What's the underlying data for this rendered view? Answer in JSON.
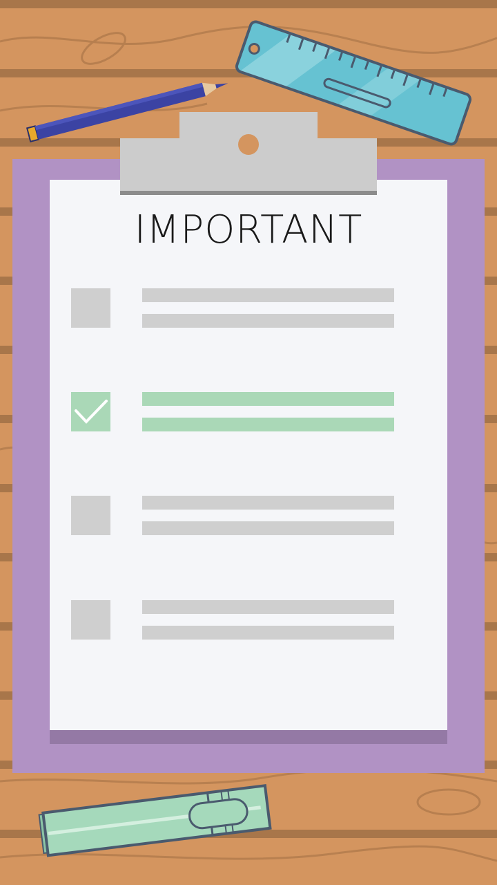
{
  "title": "IMPORTANT",
  "colors": {
    "wood": "#d4955f",
    "plank_line": "#a8764a",
    "clipboard": "#b192c4",
    "clipboard_bottom": "#9479a5",
    "paper": "#f5f6f9",
    "clip": "#cccccc",
    "placeholder": "#cfcfcf",
    "checked": "#aad8b7",
    "pencil": "#3b43a3",
    "ruler": "#66c2d2",
    "marker": "#a5d9bb"
  },
  "checklist": [
    {
      "checked": false
    },
    {
      "checked": true
    },
    {
      "checked": false
    },
    {
      "checked": false
    }
  ],
  "icons": [
    "pencil-icon",
    "ruler-icon",
    "marker-icon",
    "checkmark-icon"
  ]
}
